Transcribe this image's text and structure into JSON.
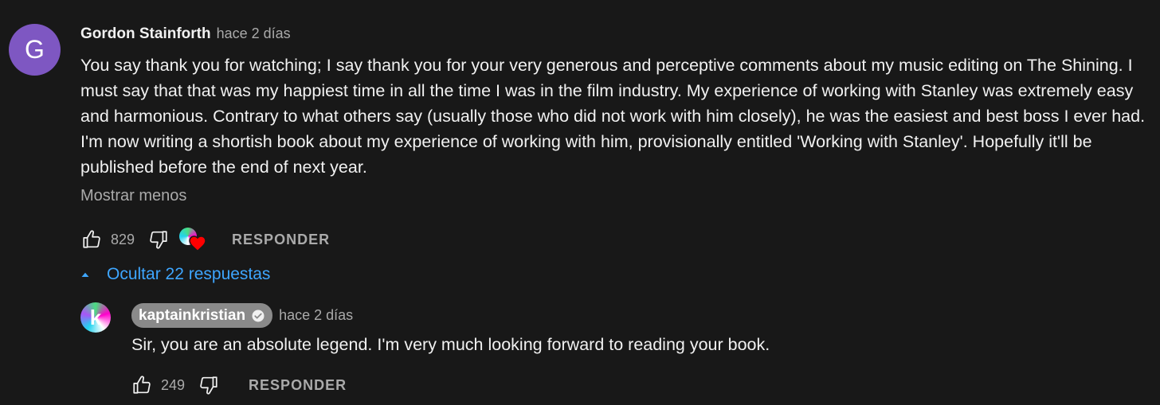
{
  "comment": {
    "avatar_letter": "G",
    "avatar_color": "#7e57c2",
    "author": "Gordon Stainforth",
    "time": "hace 2 días",
    "body": "You say thank you for watching; I say thank you for your very generous and perceptive comments about my music editing on The Shining. I must say that that was my happiest time in all the time I was in the film industry. My experience of working with Stanley was extremely easy and harmonious. Contrary to what others say (usually those who did not work with him closely), he was the easiest and best boss I ever had. I'm now writing a shortish book about my experience of working with him, provisionally entitled 'Working with Stanley'. Hopefully it'll be published before the end of next year.",
    "show_less_label": "Mostrar menos",
    "like_count": "829",
    "reply_label": "RESPONDER",
    "creator_heart": true
  },
  "replies_toggle": {
    "label": "Ocultar 22 respuestas",
    "icon": "caret-up-icon",
    "color": "#3ea6ff"
  },
  "reply": {
    "avatar_letter": "k",
    "author": "kaptainkristian",
    "verified": true,
    "time": "hace 2 días",
    "body": "Sir, you are an absolute legend. I'm very much looking forward to reading your book.",
    "like_count": "249",
    "reply_label": "RESPONDER"
  },
  "icons": {
    "like": "thumbs-up-icon",
    "dislike": "thumbs-down-icon",
    "heart": "heart-icon",
    "verified": "verified-check-icon"
  }
}
